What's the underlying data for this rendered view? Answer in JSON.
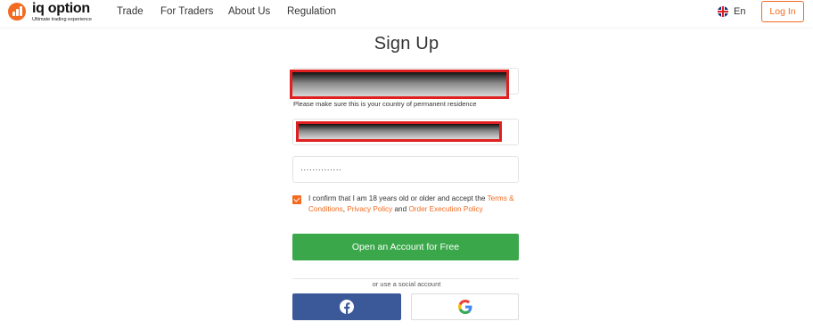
{
  "brand": {
    "name": "iq option",
    "tagline": "Ultimate trading experience",
    "accent": "#f26b21"
  },
  "nav": {
    "items": [
      "Trade",
      "For Traders",
      "About Us",
      "Regulation"
    ]
  },
  "header": {
    "language": "En",
    "login_label": "Log In"
  },
  "form": {
    "title": "Sign Up",
    "country_hint": "Please make sure this is your country of permanent residence",
    "password_value": "··············",
    "consent": {
      "text_prefix": "I confirm that I am 18 years old or older and accept the ",
      "terms_link": "Terms & Conditions",
      "sep": ", ",
      "privacy_link": "Privacy Policy",
      "and": " and ",
      "execution_link": "Order Execution Policy",
      "checked": true
    },
    "submit_label": "Open an Account for Free",
    "social_divider": "or use a social account",
    "social": [
      "facebook-icon",
      "google-icon"
    ]
  },
  "colors": {
    "cta": "#3aa84a",
    "facebook": "#3b5998",
    "redaction_border": "#e02020"
  }
}
